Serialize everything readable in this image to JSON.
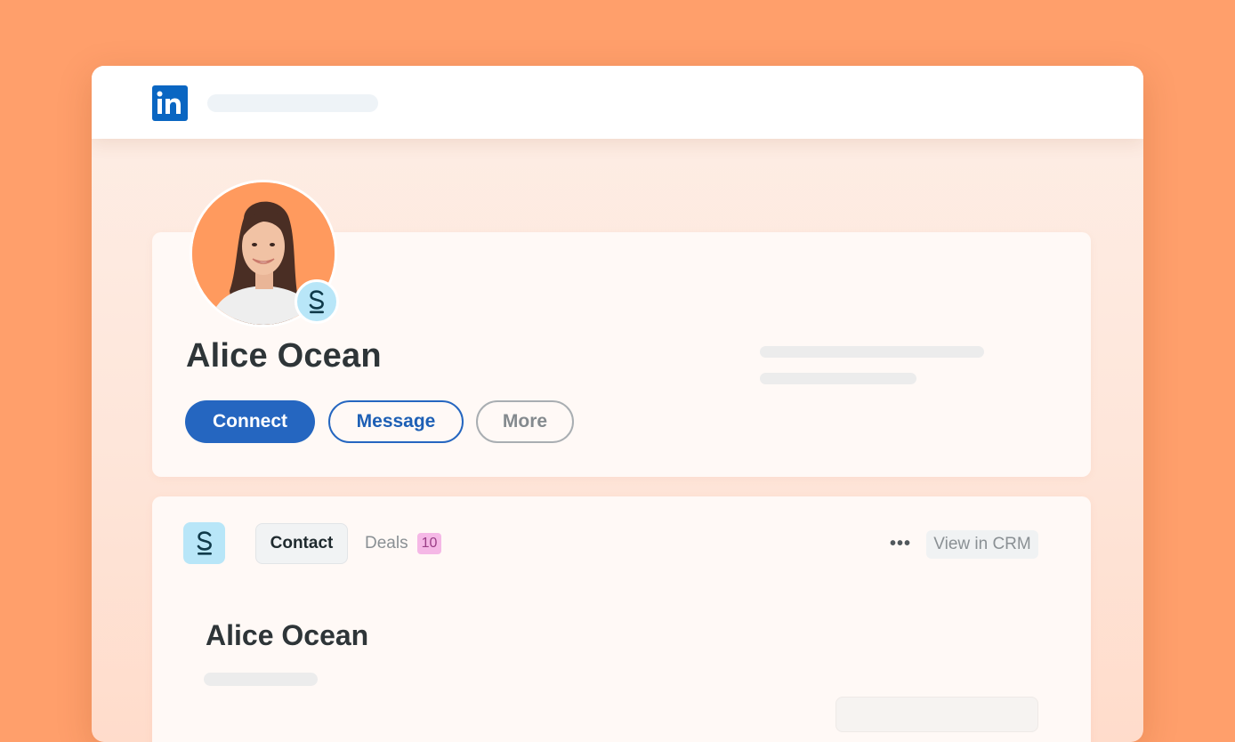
{
  "window": {
    "logo_icon": "linkedin-logo-icon",
    "brand_color": "#0A66C2"
  },
  "profile": {
    "name": "Alice Ocean",
    "badge_icon": "s-brand-icon",
    "actions": {
      "connect": "Connect",
      "message": "Message",
      "more": "More"
    }
  },
  "crm_panel": {
    "logo_icon": "s-brand-icon",
    "tabs": {
      "contact": "Contact",
      "deals": "Deals",
      "deals_count": "10"
    },
    "more_icon": "ellipsis-icon",
    "more_label": "•••",
    "view_in_crm": "View in CRM",
    "contact_name": "Alice Ocean"
  }
}
